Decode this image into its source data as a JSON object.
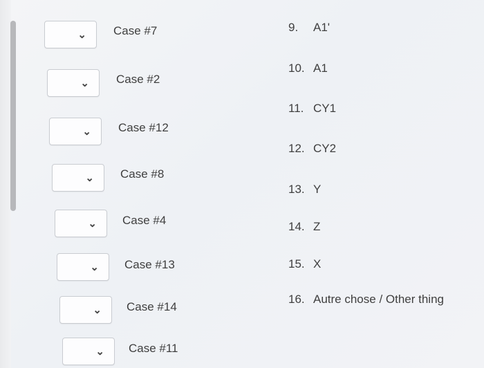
{
  "rows": [
    {
      "case": "Case #7"
    },
    {
      "case": "Case #2"
    },
    {
      "case": "Case #12"
    },
    {
      "case": "Case #8"
    },
    {
      "case": "Case #4"
    },
    {
      "case": "Case #13"
    },
    {
      "case": "Case #14"
    },
    {
      "case": "Case #11"
    }
  ],
  "options": [
    {
      "num": "9.",
      "text": "A1'"
    },
    {
      "num": "10.",
      "text": "A1"
    },
    {
      "num": "11.",
      "text": "CY1"
    },
    {
      "num": "12.",
      "text": "CY2"
    },
    {
      "num": "13.",
      "text": "Y"
    },
    {
      "num": "14.",
      "text": "Z"
    },
    {
      "num": "15.",
      "text": "X"
    },
    {
      "num": "16.",
      "text": "Autre chose / Other thing"
    }
  ],
  "icons": {
    "dropdown": "chevron-down-icon"
  }
}
